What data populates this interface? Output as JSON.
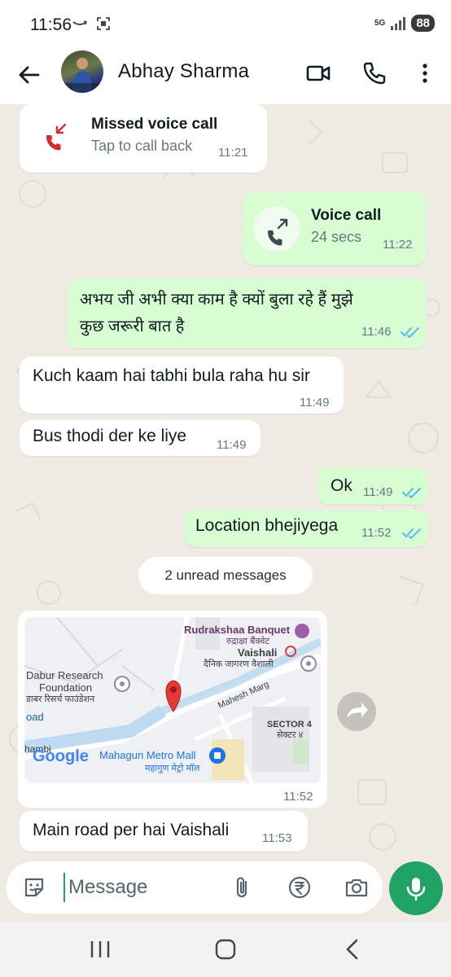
{
  "status_bar": {
    "time": "11:56",
    "network": "5G",
    "battery": "88"
  },
  "header": {
    "contact_name": "Abhay Sharma"
  },
  "messages": {
    "m1": {
      "title": "Missed voice call",
      "subtitle": "Tap to call back",
      "time": "11:21"
    },
    "m2": {
      "title": "Voice call",
      "subtitle": "24 secs",
      "time": "11:22"
    },
    "m3": {
      "line1": "अभय जी अभी क्या काम है क्यों बुला रहे हैं मुझे",
      "line2": "कुछ जरूरी बात है",
      "time": "11:46"
    },
    "m4": {
      "text": "Kuch kaam hai tabhi bula raha hu sir",
      "time": "11:49"
    },
    "m5": {
      "text": "Bus thodi der ke liye",
      "time": "11:49"
    },
    "m6": {
      "text": "Ok",
      "time": "11:49"
    },
    "m7": {
      "text": "Location bhejiyega",
      "time": "11:52"
    },
    "unread_label": "2 unread messages",
    "map": {
      "time": "11:52",
      "poi_banquet": "Rudrakshaa Banquet",
      "poi_banquet_hi": "रुद्राक्षा बैंक्वेट",
      "poi_vaishali": "Vaishali",
      "poi_vaishali_hi": "दैनिक जागरण वैशाली",
      "poi_dabur_1": "Dabur Research",
      "poi_dabur_2": "Foundation",
      "poi_dabur_hi": "डाबर रिसर्च फाउंडेशन",
      "road_fragment": "oad",
      "road_mahesh": "Mahesh Marg",
      "sector": "SECTOR 4",
      "sector_hi": "सेक्टर ४",
      "fragment_left": "hambi",
      "brand": "Google",
      "poi_mall": "Mahagun Metro Mall",
      "poi_mall_hi": "महागुण मेट्रो मॉल"
    },
    "m8": {
      "text": "Main road per hai Vaishali",
      "time": "11:53"
    }
  },
  "composer": {
    "placeholder": "Message"
  },
  "colors": {
    "outgoing_bubble": "#d9fdd3",
    "incoming_bubble": "#ffffff",
    "chat_background": "#efeae2",
    "read_ticks": "#53bdeb",
    "missed_call_red": "#d42f2f",
    "mic_button": "#21a366"
  },
  "icons": [
    "back-arrow-icon",
    "video-call-icon",
    "phone-icon",
    "more-vert-icon",
    "missed-call-icon",
    "outgoing-call-icon",
    "read-ticks-icon",
    "map-pin-icon",
    "forward-icon",
    "sticker-icon",
    "attach-icon",
    "rupee-icon",
    "camera-icon",
    "mic-icon"
  ]
}
